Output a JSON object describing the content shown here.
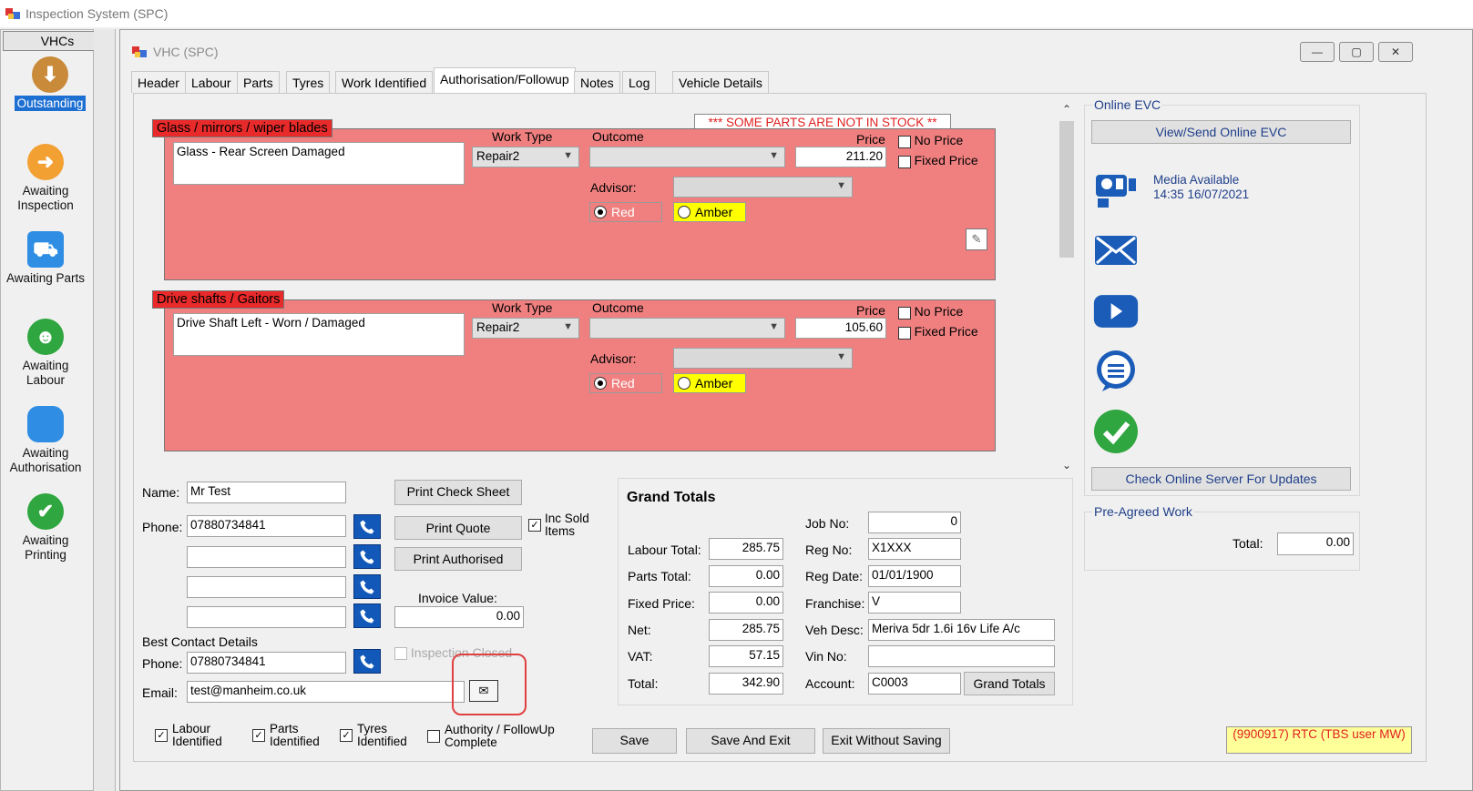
{
  "window": {
    "title": "Inspection System (SPC)"
  },
  "child": {
    "title": "VHC (SPC)"
  },
  "leftnav": {
    "header": "VHCs",
    "items": [
      {
        "label": "Outstanding",
        "icon": "down-arrow-icon",
        "color": "#c98a3a"
      },
      {
        "label": "Awaiting Inspection",
        "icon": "right-arrow-icon",
        "color": "#f3a033"
      },
      {
        "label": "Awaiting Parts",
        "icon": "cart-icon",
        "color": "#2f8de4"
      },
      {
        "label": "Awaiting Labour",
        "icon": "person-icon",
        "color": "#2fa63f"
      },
      {
        "label": "Awaiting Authorisation",
        "icon": "speech-bubble-icon",
        "color": "#2f8de4"
      },
      {
        "label": "Awaiting Printing",
        "icon": "check-icon",
        "color": "#2fa63f"
      }
    ]
  },
  "tabs": [
    "Header",
    "Labour",
    "Parts",
    "Tyres",
    "Work Identified",
    "Authorisation/Followup",
    "Notes",
    "Log",
    "Vehicle Details"
  ],
  "stock_warning": "*** SOME PARTS ARE NOT IN STOCK **",
  "items": [
    {
      "category": "Glass / mirrors / wiper blades",
      "description": "Glass - Rear Screen Damaged",
      "work_type_label": "Work Type",
      "work_type": "Repair2",
      "outcome_label": "Outcome",
      "outcome": "",
      "price_label": "Price",
      "price": "211.20",
      "no_price": "No Price",
      "fixed_price": "Fixed Price",
      "advisor_label": "Advisor:",
      "red": "Red",
      "amber": "Amber"
    },
    {
      "category": "Drive shafts / Gaitors",
      "description": "Drive Shaft Left - Worn / Damaged",
      "work_type_label": "Work Type",
      "work_type": "Repair2",
      "outcome_label": "Outcome",
      "outcome": "",
      "price_label": "Price",
      "price": "105.60",
      "no_price": "No Price",
      "fixed_price": "Fixed Price",
      "advisor_label": "Advisor:",
      "red": "Red",
      "amber": "Amber"
    }
  ],
  "customer": {
    "name_label": "Name:",
    "name": "Mr Test",
    "phone_label": "Phone:",
    "phones": [
      "07880734841",
      "",
      "",
      ""
    ],
    "best_contact_label": "Best Contact Details",
    "best_phone_label": "Phone:",
    "best_phone": "07880734841",
    "email_label": "Email:",
    "email": "test@manheim.co.uk"
  },
  "actions": {
    "print_check_sheet": "Print Check Sheet",
    "print_quote": "Print Quote",
    "inc_sold_items": "Inc Sold Items",
    "print_authorised": "Print Authorised",
    "invoice_value_label": "Invoice Value:",
    "invoice_value": "0.00",
    "inspection_closed": "Inspection Closed"
  },
  "grand_totals": {
    "title": "Grand Totals",
    "labour_total_label": "Labour Total:",
    "labour_total": "285.75",
    "parts_total_label": "Parts Total:",
    "parts_total": "0.00",
    "fixed_price_label": "Fixed Price:",
    "fixed_price": "0.00",
    "net_label": "Net:",
    "net": "285.75",
    "vat_label": "VAT:",
    "vat": "57.15",
    "total_label": "Total:",
    "total": "342.90",
    "job_no_label": "Job No:",
    "job_no": "0",
    "reg_no_label": "Reg No:",
    "reg_no": "X1XXX",
    "reg_date_label": "Reg Date:",
    "reg_date": "01/01/1900",
    "franchise_label": "Franchise:",
    "franchise": "V",
    "veh_desc_label": "Veh Desc:",
    "veh_desc": "Meriva 5dr 1.6i 16v Life A/c",
    "vin_no_label": "Vin No:",
    "vin_no": "",
    "account_label": "Account:",
    "account": "C0003",
    "grand_totals_button": "Grand Totals"
  },
  "online_evc": {
    "group_label": "Online EVC",
    "view_send": "View/Send Online EVC",
    "media_line1": "Media Available",
    "media_line2": "14:35 16/07/2021",
    "check_server": "Check Online Server For Updates"
  },
  "pre_agreed": {
    "group_label": "Pre-Agreed Work",
    "total_label": "Total:",
    "total": "0.00"
  },
  "footer": {
    "labour_identified": "Labour Identified",
    "parts_identified": "Parts Identified",
    "tyres_identified": "Tyres Identified",
    "authority_complete": "Authority / FollowUp Complete",
    "save": "Save",
    "save_and_exit": "Save And Exit",
    "exit_without_saving": "Exit Without Saving",
    "status": "(9900917) RTC (TBS user MW)"
  }
}
